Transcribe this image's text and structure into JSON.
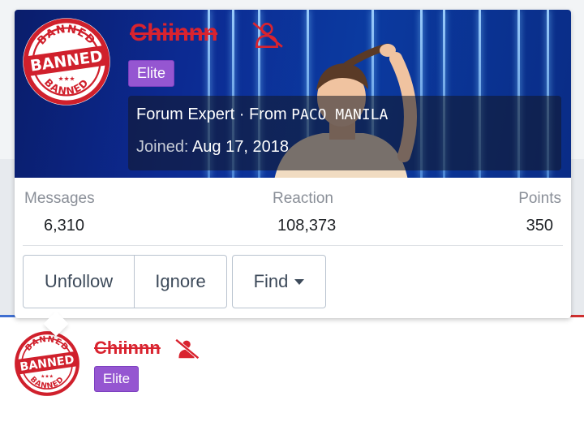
{
  "user": {
    "username": "Chiinnn",
    "banned_stamp": {
      "arc_top": "BANNED",
      "center": "BANNED",
      "arc_bottom": "BANNED",
      "stars": "★★★"
    },
    "group_badge": "Elite",
    "title": "Forum Expert",
    "separator": " · ",
    "from_label": "From",
    "location": "PACO MANILA",
    "joined_label": "Joined:",
    "joined_date": "Aug 17, 2018"
  },
  "stats": [
    {
      "label": "Messages",
      "value": "6,310"
    },
    {
      "label": "Reaction",
      "value": "108,373"
    },
    {
      "label": "Points",
      "value": "350"
    }
  ],
  "actions": {
    "unfollow": "Unfollow",
    "ignore": "Ignore",
    "find": "Find"
  },
  "colors": {
    "banned_red": "#d9232f",
    "badge_purple": "#9556d1",
    "banner_blue": "#0b2e92"
  },
  "icons": {
    "user_slash": "user-slash-icon",
    "caret": "caret-down-icon"
  }
}
